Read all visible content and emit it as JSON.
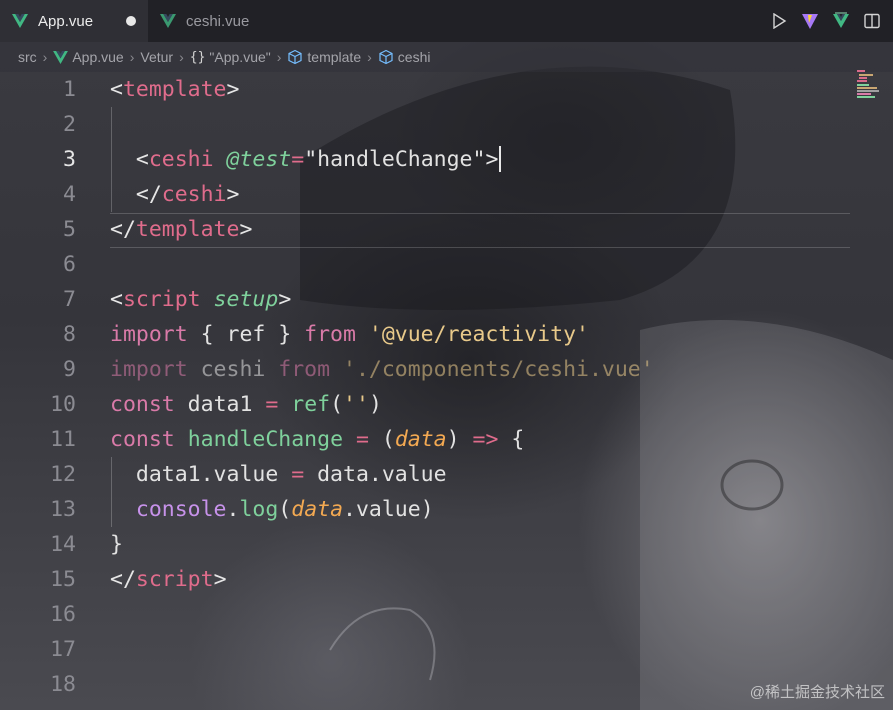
{
  "tabs": [
    {
      "label": "App.vue",
      "active": true,
      "modified": true
    },
    {
      "label": "ceshi.vue",
      "active": false,
      "modified": false
    }
  ],
  "breadcrumb": [
    "src",
    "App.vue",
    "Vetur",
    "\"App.vue\"",
    "template",
    "ceshi"
  ],
  "editor": {
    "current_line": 3,
    "line_numbers": [
      "1",
      "2",
      "3",
      "4",
      "5",
      "6",
      "7",
      "8",
      "9",
      "10",
      "11",
      "12",
      "13",
      "14",
      "15",
      "16",
      "17",
      "18"
    ],
    "lines": [
      [
        [
          "br",
          "<"
        ],
        [
          "tag",
          "template"
        ],
        [
          "br",
          ">"
        ]
      ],
      [],
      [
        [
          "plain",
          "  "
        ],
        [
          "br",
          "<"
        ],
        [
          "tag",
          "ceshi"
        ],
        [
          "plain",
          " "
        ],
        [
          "attr",
          "@test"
        ],
        [
          "op",
          "="
        ],
        [
          "br",
          "\""
        ],
        [
          "plain",
          "handleChange"
        ],
        [
          "br",
          "\">"
        ]
      ],
      [
        [
          "plain",
          "  "
        ],
        [
          "br",
          "</"
        ],
        [
          "tag",
          "ceshi"
        ],
        [
          "br",
          ">"
        ]
      ],
      [
        [
          "br",
          "</"
        ],
        [
          "tag",
          "template"
        ],
        [
          "br",
          ">"
        ]
      ],
      [],
      [
        [
          "br",
          "<"
        ],
        [
          "tag",
          "script"
        ],
        [
          "plain",
          " "
        ],
        [
          "attr",
          "setup"
        ],
        [
          "br",
          ">"
        ]
      ],
      [
        [
          "kw",
          "import"
        ],
        [
          "plain",
          " { ref } "
        ],
        [
          "kw",
          "from"
        ],
        [
          "plain",
          " "
        ],
        [
          "str",
          "'@vue/reactivity'"
        ]
      ],
      [
        [
          "kw-dim",
          "import"
        ],
        [
          "plain-dim",
          " ceshi "
        ],
        [
          "kw-dim",
          "from"
        ],
        [
          "plain-dim",
          " "
        ],
        [
          "str-dim",
          "'./components/ceshi.vue'"
        ]
      ],
      [
        [
          "kw",
          "const"
        ],
        [
          "plain",
          " data1 "
        ],
        [
          "op",
          "="
        ],
        [
          "plain",
          " "
        ],
        [
          "fn",
          "ref"
        ],
        [
          "plain",
          "("
        ],
        [
          "str",
          "''"
        ],
        [
          "plain",
          ")"
        ]
      ],
      [
        [
          "kw",
          "const"
        ],
        [
          "plain",
          " "
        ],
        [
          "fn",
          "handleChange"
        ],
        [
          "plain",
          " "
        ],
        [
          "op",
          "="
        ],
        [
          "plain",
          " ("
        ],
        [
          "param",
          "data"
        ],
        [
          "plain",
          ") "
        ],
        [
          "op",
          "=>"
        ],
        [
          "plain",
          " {"
        ]
      ],
      [
        [
          "plain",
          "  data1.value "
        ],
        [
          "op",
          "="
        ],
        [
          "plain",
          " data.value"
        ]
      ],
      [
        [
          "plain",
          "  "
        ],
        [
          "obj",
          "console"
        ],
        [
          "plain",
          "."
        ],
        [
          "fn",
          "log"
        ],
        [
          "plain",
          "("
        ],
        [
          "param",
          "data"
        ],
        [
          "plain",
          ".value)"
        ]
      ],
      [
        [
          "plain",
          "}"
        ]
      ],
      [
        [
          "br",
          "</"
        ],
        [
          "tag",
          "script"
        ],
        [
          "br",
          ">"
        ]
      ],
      [],
      [],
      []
    ]
  },
  "watermark": "@稀土掘金技术社区",
  "icons": {
    "tab": "vue-logo-icon",
    "actions": [
      "run-icon",
      "vite-icon",
      "vue-devtools-icon",
      "split-editor-icon"
    ]
  },
  "colors": {
    "vue_green": "#41b883",
    "vue_dark": "#35495e",
    "tag": "#e06c8c",
    "attr": "#7fd19c",
    "string": "#e8c98a",
    "keyword": "#d97aa8",
    "param": "#f3a952"
  }
}
